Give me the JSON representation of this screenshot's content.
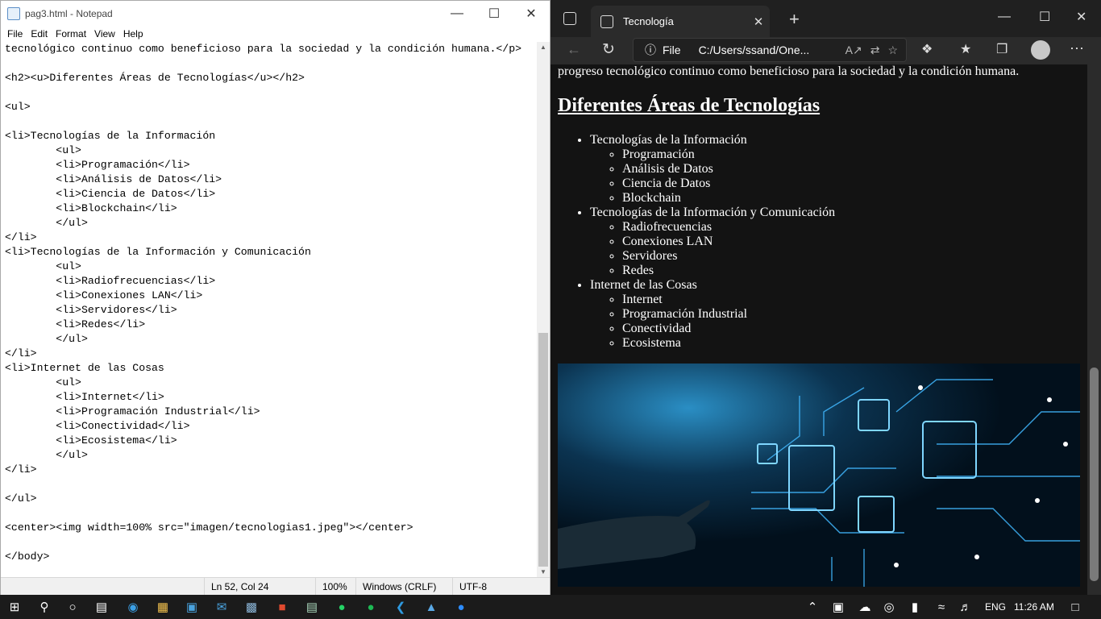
{
  "notepad": {
    "title": "pag3.html - Notepad",
    "menu": [
      "File",
      "Edit",
      "Format",
      "View",
      "Help"
    ],
    "lines": [
      "tecnológico continuo como beneficioso para la sociedad y la condición humana.</p>",
      "",
      "<h2><u>Diferentes Áreas de Tecnologías</u></h2>",
      "",
      "<ul>",
      "",
      "<li>Tecnologías de la Información",
      "        <ul>",
      "        <li>Programación</li>",
      "        <li>Análisis de Datos</li>",
      "        <li>Ciencia de Datos</li>",
      "        <li>Blockchain</li>",
      "        </ul>",
      "</li>",
      "<li>Tecnologías de la Información y Comunicación",
      "        <ul>",
      "        <li>Radiofrecuencias</li>",
      "        <li>Conexiones LAN</li>",
      "        <li>Servidores</li>",
      "        <li>Redes</li>",
      "        </ul>",
      "</li>",
      "<li>Internet de las Cosas",
      "        <ul>",
      "        <li>Internet</li>",
      "        <li>Programación Industrial</li>",
      "        <li>Conectividad</li>",
      "        <li>Ecosistema</li>",
      "        </ul>",
      "</li>",
      "",
      "</ul>",
      "",
      "<center><img width=100% src=\"imagen/tecnologias1.jpeg\"></center>",
      "",
      "</body>"
    ],
    "status": {
      "position": "Ln 52, Col 24",
      "zoom": "100%",
      "eol": "Windows (CRLF)",
      "encoding": "UTF-8"
    }
  },
  "browser": {
    "tab_title": "Tecnología",
    "address_label": "File",
    "address": "C:/Users/ssand/One...",
    "page": {
      "intro": "progreso tecnológico continuo como beneficioso para la sociedad y la condición humana.",
      "heading": "Diferentes Áreas de Tecnologías",
      "groups": [
        {
          "label": "Tecnologías de la Información",
          "items": [
            "Programación",
            "Análisis de Datos",
            "Ciencia de Datos",
            "Blockchain"
          ]
        },
        {
          "label": "Tecnologías de la Información y Comunicación",
          "items": [
            "Radiofrecuencias",
            "Conexiones LAN",
            "Servidores",
            "Redes"
          ]
        },
        {
          "label": "Internet de las Cosas",
          "items": [
            "Internet",
            "Programación Industrial",
            "Conectividad",
            "Ecosistema"
          ]
        }
      ]
    }
  },
  "taskbar": {
    "lang": "ENG",
    "time": "11:26 AM"
  },
  "colors": {
    "accent": "#0a6fd6",
    "browser_bg": "#131313",
    "circuit": "#41b8ff"
  }
}
